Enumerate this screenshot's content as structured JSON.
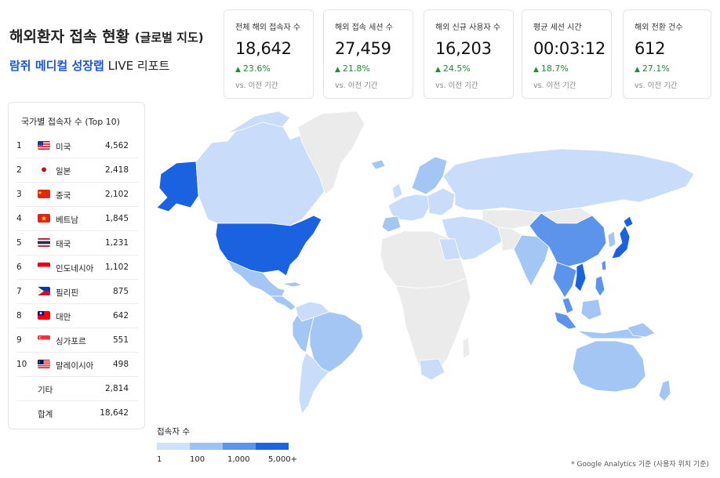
{
  "header": {
    "title": "해외환자 접속 현황",
    "title_sub": "(글로벌 지도)",
    "subtitle_brand": "람쥐 메디컬 성장랩",
    "subtitle_rest": "LIVE 리포트"
  },
  "kpis": [
    {
      "label": "전체 해외 접속자 수",
      "value": "18,642",
      "change": "23.6%",
      "prev": "vs. 이전 기간"
    },
    {
      "label": "해외 접속 세션 수",
      "value": "27,459",
      "change": "21.8%",
      "prev": "vs. 이전 기간"
    },
    {
      "label": "해외 신규 사용자 수",
      "value": "16,203",
      "change": "24.5%",
      "prev": "vs. 이전 기간"
    },
    {
      "label": "평균 세션 시간",
      "value": "00:03:12",
      "change": "18.7%",
      "prev": "vs. 이전 기간"
    },
    {
      "label": "해외 전환 건수",
      "value": "612",
      "change": "27.1%",
      "prev": "vs. 이전 기간"
    }
  ],
  "panel": {
    "title": "국가별 접속자 수 (Top 10)",
    "rows": [
      {
        "rank": "1",
        "flag": "us-flag-icon",
        "name": "미국",
        "value": "4,562"
      },
      {
        "rank": "2",
        "flag": "jp-flag-icon",
        "name": "일본",
        "value": "2,418"
      },
      {
        "rank": "3",
        "flag": "cn-flag-icon",
        "name": "중국",
        "value": "2,102"
      },
      {
        "rank": "4",
        "flag": "vn-flag-icon",
        "name": "베트남",
        "value": "1,845"
      },
      {
        "rank": "5",
        "flag": "th-flag-icon",
        "name": "태국",
        "value": "1,231"
      },
      {
        "rank": "6",
        "flag": "id-flag-icon",
        "name": "인도네시아",
        "value": "1,102"
      },
      {
        "rank": "7",
        "flag": "ph-flag-icon",
        "name": "필리핀",
        "value": "875"
      },
      {
        "rank": "8",
        "flag": "tw-flag-icon",
        "name": "대만",
        "value": "642"
      },
      {
        "rank": "9",
        "flag": "sg-flag-icon",
        "name": "싱가포르",
        "value": "551"
      },
      {
        "rank": "10",
        "flag": "my-flag-icon",
        "name": "말레이시아",
        "value": "498"
      }
    ],
    "other_label": "기타",
    "other_value": "2,814",
    "total_label": "합계",
    "total_value": "18,642"
  },
  "chart_data": {
    "type": "choropleth",
    "categories": [
      "미국",
      "일본",
      "중국",
      "베트남",
      "태국",
      "인도네시아",
      "필리핀",
      "대만",
      "싱가포르",
      "말레이시아"
    ],
    "values": [
      4562,
      2418,
      2102,
      1845,
      1231,
      1102,
      875,
      642,
      551,
      498
    ],
    "other": 2814,
    "total": 18642,
    "legend_title": "접속자 수",
    "legend_ticks": [
      "1",
      "100",
      "1,000",
      "5,000+"
    ],
    "legend_colors": [
      "#cfe1fb",
      "#9cc3f6",
      "#5c96ec",
      "#1e63e0"
    ],
    "no_data_color": "#ebebeb"
  },
  "colors": {
    "accent": "#1a55d4",
    "positive": "#1f8a3a",
    "level0": "#ebebeb",
    "level1": "#c9ddfa",
    "level2": "#a3c6f5",
    "level3": "#5b94ea",
    "level4": "#1a62e0"
  },
  "footnote": "* Google Analytics 기준 (사용자 위치 기준)"
}
